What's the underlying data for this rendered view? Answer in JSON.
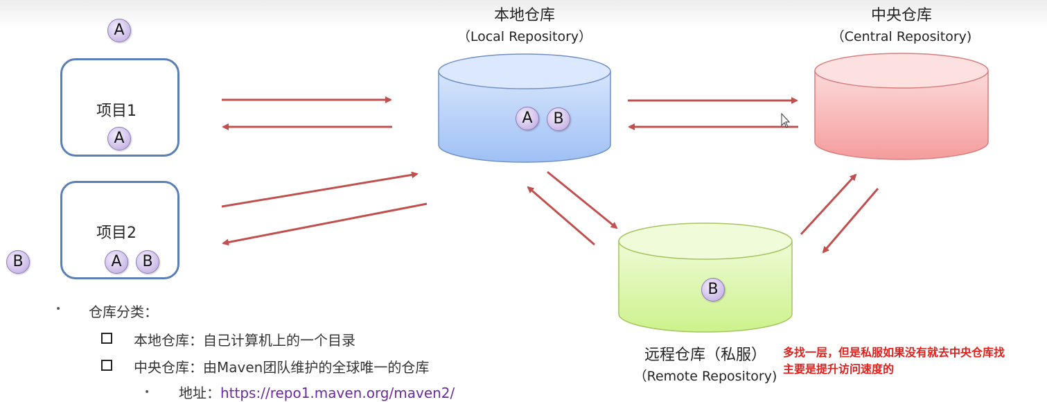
{
  "local_repo": {
    "title": "本地仓库",
    "subtitle": "（Local Repository）"
  },
  "central_repo": {
    "title": "中央仓库",
    "subtitle": "（Central Repository)"
  },
  "remote_repo": {
    "title": "远程仓库（私服）",
    "subtitle": "（Remote Repository)"
  },
  "projects": [
    {
      "label": "项目1",
      "badges": [
        "A"
      ]
    },
    {
      "label": "项目2",
      "badges": [
        "A",
        "B"
      ]
    }
  ],
  "floating_badges": {
    "top_left": "A",
    "left_mid": "B"
  },
  "local_badges": [
    "A",
    "B"
  ],
  "remote_badges": [
    "B"
  ],
  "bullets": {
    "heading": "仓库分类：",
    "items": [
      "本地仓库：自己计算机上的一个目录",
      "中央仓库：由Maven团队维护的全球唯一的仓库"
    ],
    "sub_label": "地址：",
    "sub_url": "https://repo1.maven.org/maven2/"
  },
  "note": {
    "line1": "多找一层，但是私服如果没有就去中央仓库找",
    "line2": "主要是提升访问速度的"
  },
  "colors": {
    "arrow": "#c0504d",
    "local_fill": "#9fc0f5",
    "central_fill": "#f59c9c",
    "remote_fill": "#cdf28c",
    "project_border": "#5a7fb5",
    "note": "#e0201b"
  }
}
